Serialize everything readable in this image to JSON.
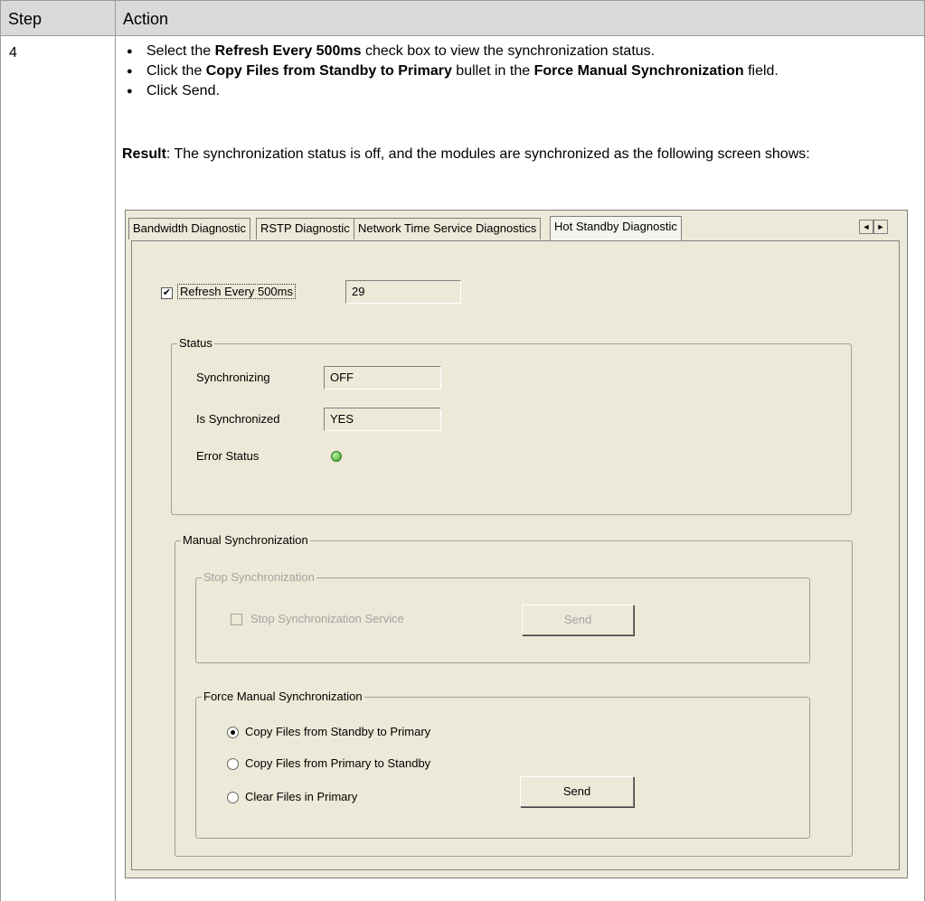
{
  "table": {
    "header_step": "Step",
    "header_action": "Action",
    "step_number": "4"
  },
  "instructions": {
    "b1_pre": "Select the ",
    "b1_bold": "Refresh Every 500ms",
    "b1_post": " check box to view the synchronization status.",
    "b2_pre": "Click the ",
    "b2_bold1": "Copy Files from Standby to Primary",
    "b2_mid": " bullet in the ",
    "b2_bold2": "Force Manual Synchronization",
    "b2_post": " field.",
    "b3": "Click Send.",
    "result_label": "Result",
    "result_text": ": The synchronization status is off, and the modules are synchronized as the following screen shows:"
  },
  "dialog": {
    "tabs": [
      {
        "label": "Bandwidth Diagnostic",
        "active": false
      },
      {
        "label": "RSTP Diagnostic",
        "active": false
      },
      {
        "label": "Network Time Service Diagnostics",
        "active": false
      },
      {
        "label": "Hot Standby Diagnostic",
        "active": true
      }
    ],
    "scroll_left_icon": "◄",
    "scroll_right_icon": "►",
    "refresh_label": "Refresh Every 500ms",
    "refresh_checked": true,
    "refresh_value": "29",
    "status": {
      "title": "Status",
      "synchronizing_label": "Synchronizing",
      "synchronizing_value": "OFF",
      "is_synchronized_label": "Is Synchronized",
      "is_synchronized_value": "YES",
      "error_status_label": "Error Status",
      "error_status_color": "#4caf3a"
    },
    "manual_sync": {
      "title": "Manual Synchronization",
      "stop": {
        "title": "Stop Synchronization",
        "checkbox_label": "Stop Synchronization Service",
        "send_label": "Send"
      },
      "force": {
        "title": "Force Manual Synchronization",
        "options": [
          {
            "label": "Copy Files from Standby to Primary",
            "selected": true
          },
          {
            "label": "Copy Files from Primary to Standby",
            "selected": false
          },
          {
            "label": "Clear Files in Primary",
            "selected": false
          }
        ],
        "send_label": "Send"
      }
    }
  }
}
